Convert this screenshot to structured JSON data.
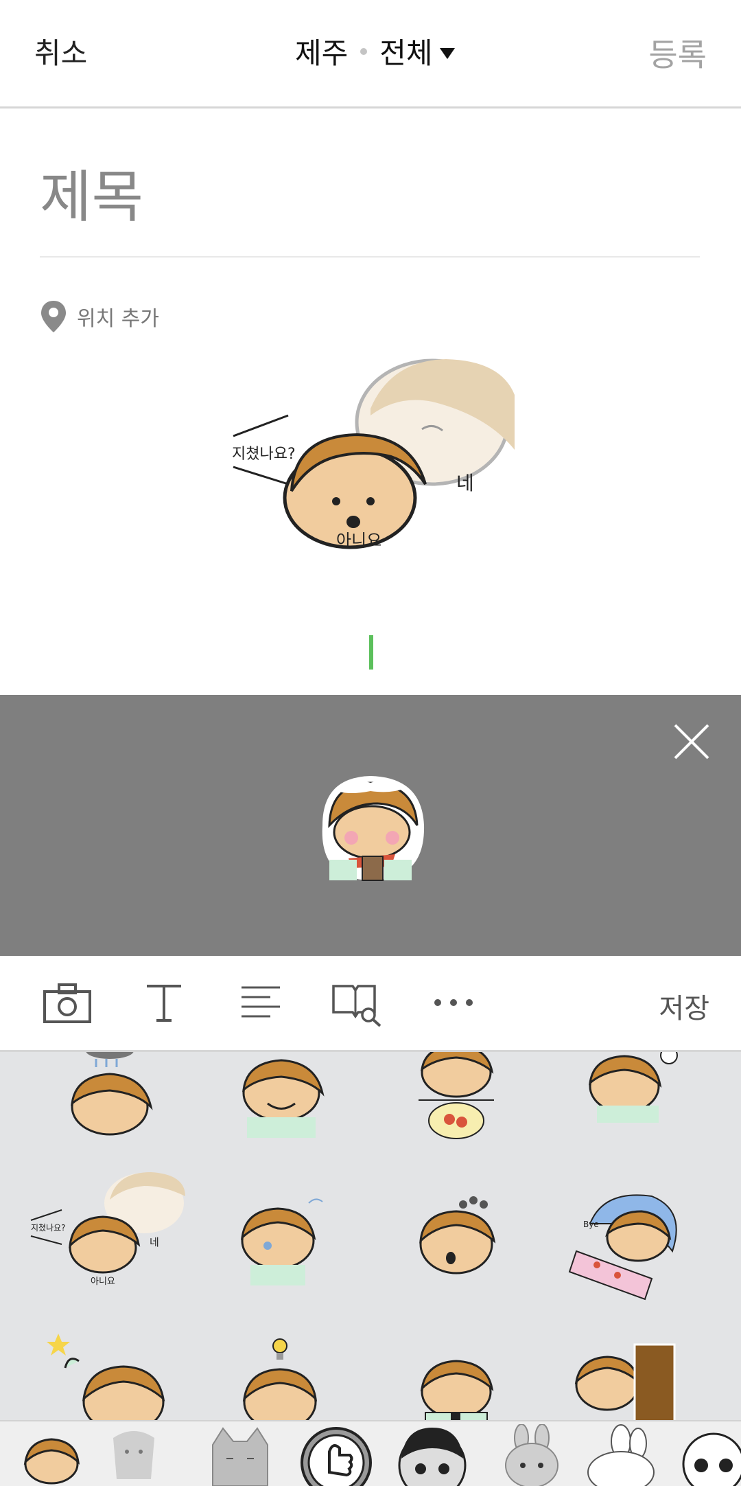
{
  "header": {
    "cancel_label": "취소",
    "region": "제주",
    "scope": "전체",
    "register_label": "등록"
  },
  "editor": {
    "title_placeholder": "제목",
    "location_label": "위치 추가"
  },
  "inserted_sticker": {
    "bubble_text": "지쳤나요?",
    "yes_text": "네",
    "no_text": "아니요"
  },
  "toolbar": {
    "save_label": "저장"
  },
  "sticker_grid": {
    "item_texts": {
      "tired_bubble": "지쳤나요?",
      "yes": "네",
      "no": "아니요",
      "bye": "Bye"
    }
  },
  "colors": {
    "accent_cursor": "#5cc05c",
    "preview_overlay": "#7f7f7f",
    "grid_bg": "#e3e4e6",
    "hair": "#c98a3a",
    "skin": "#f1cc9e"
  },
  "icons": [
    "camera-icon",
    "text-icon",
    "align-icon",
    "book-search-icon",
    "more-icon",
    "close-icon",
    "location-pin-icon"
  ]
}
